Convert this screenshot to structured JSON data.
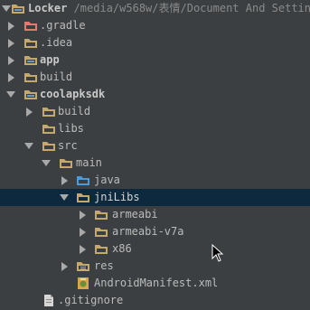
{
  "tree": {
    "root_label": "Locker",
    "root_path": " /media/w568w/表情/Document And Settin",
    "items": [
      {
        "label": "Locker",
        "path": " /media/w568w/表情/Document And Settin",
        "level": 0,
        "arrow": "expanded",
        "icon": "module-folder-icon",
        "bold": true
      },
      {
        "label": ".gradle",
        "level": 1,
        "arrow": "collapsed",
        "icon": "excluded-folder-icon"
      },
      {
        "label": ".idea",
        "level": 1,
        "arrow": "collapsed",
        "icon": "folder-icon"
      },
      {
        "label": "app",
        "level": 1,
        "arrow": "collapsed",
        "icon": "module-folder-icon",
        "bold": true
      },
      {
        "label": "build",
        "level": 1,
        "arrow": "collapsed",
        "icon": "folder-icon"
      },
      {
        "label": "coolapksdk",
        "level": 1,
        "arrow": "expanded",
        "icon": "module-folder-icon",
        "bold": true
      },
      {
        "label": "build",
        "level": 2,
        "arrow": "collapsed",
        "icon": "folder-icon"
      },
      {
        "label": "libs",
        "level": 2,
        "arrow": "none",
        "icon": "folder-icon"
      },
      {
        "label": "src",
        "level": 2,
        "arrow": "expanded",
        "icon": "folder-icon"
      },
      {
        "label": "main",
        "level": 3,
        "arrow": "expanded",
        "icon": "folder-icon"
      },
      {
        "label": "java",
        "level": 4,
        "arrow": "collapsed",
        "icon": "source-folder-icon"
      },
      {
        "label": "jniLibs",
        "level": 4,
        "arrow": "expanded",
        "icon": "folder-icon",
        "selected": true
      },
      {
        "label": "armeabi",
        "level": 5,
        "arrow": "collapsed",
        "icon": "folder-icon"
      },
      {
        "label": "armeabi-v7a",
        "level": 5,
        "arrow": "collapsed",
        "icon": "folder-icon"
      },
      {
        "label": "x86",
        "level": 5,
        "arrow": "collapsed",
        "icon": "folder-icon"
      },
      {
        "label": "res",
        "level": 4,
        "arrow": "collapsed",
        "icon": "resource-folder-icon"
      },
      {
        "label": "AndroidManifest.xml",
        "level": 4,
        "arrow": "none",
        "icon": "android-manifest-icon"
      },
      {
        "label": ".gitignore",
        "level": 2,
        "arrow": "none",
        "icon": "text-file-icon"
      }
    ]
  },
  "colors": {
    "background": "#3c3f41",
    "selection": "#0d293e",
    "text": "#bbbbbb",
    "folder": "#c5a86b",
    "excluded": "#e07b72",
    "source": "#4e9ad6"
  }
}
